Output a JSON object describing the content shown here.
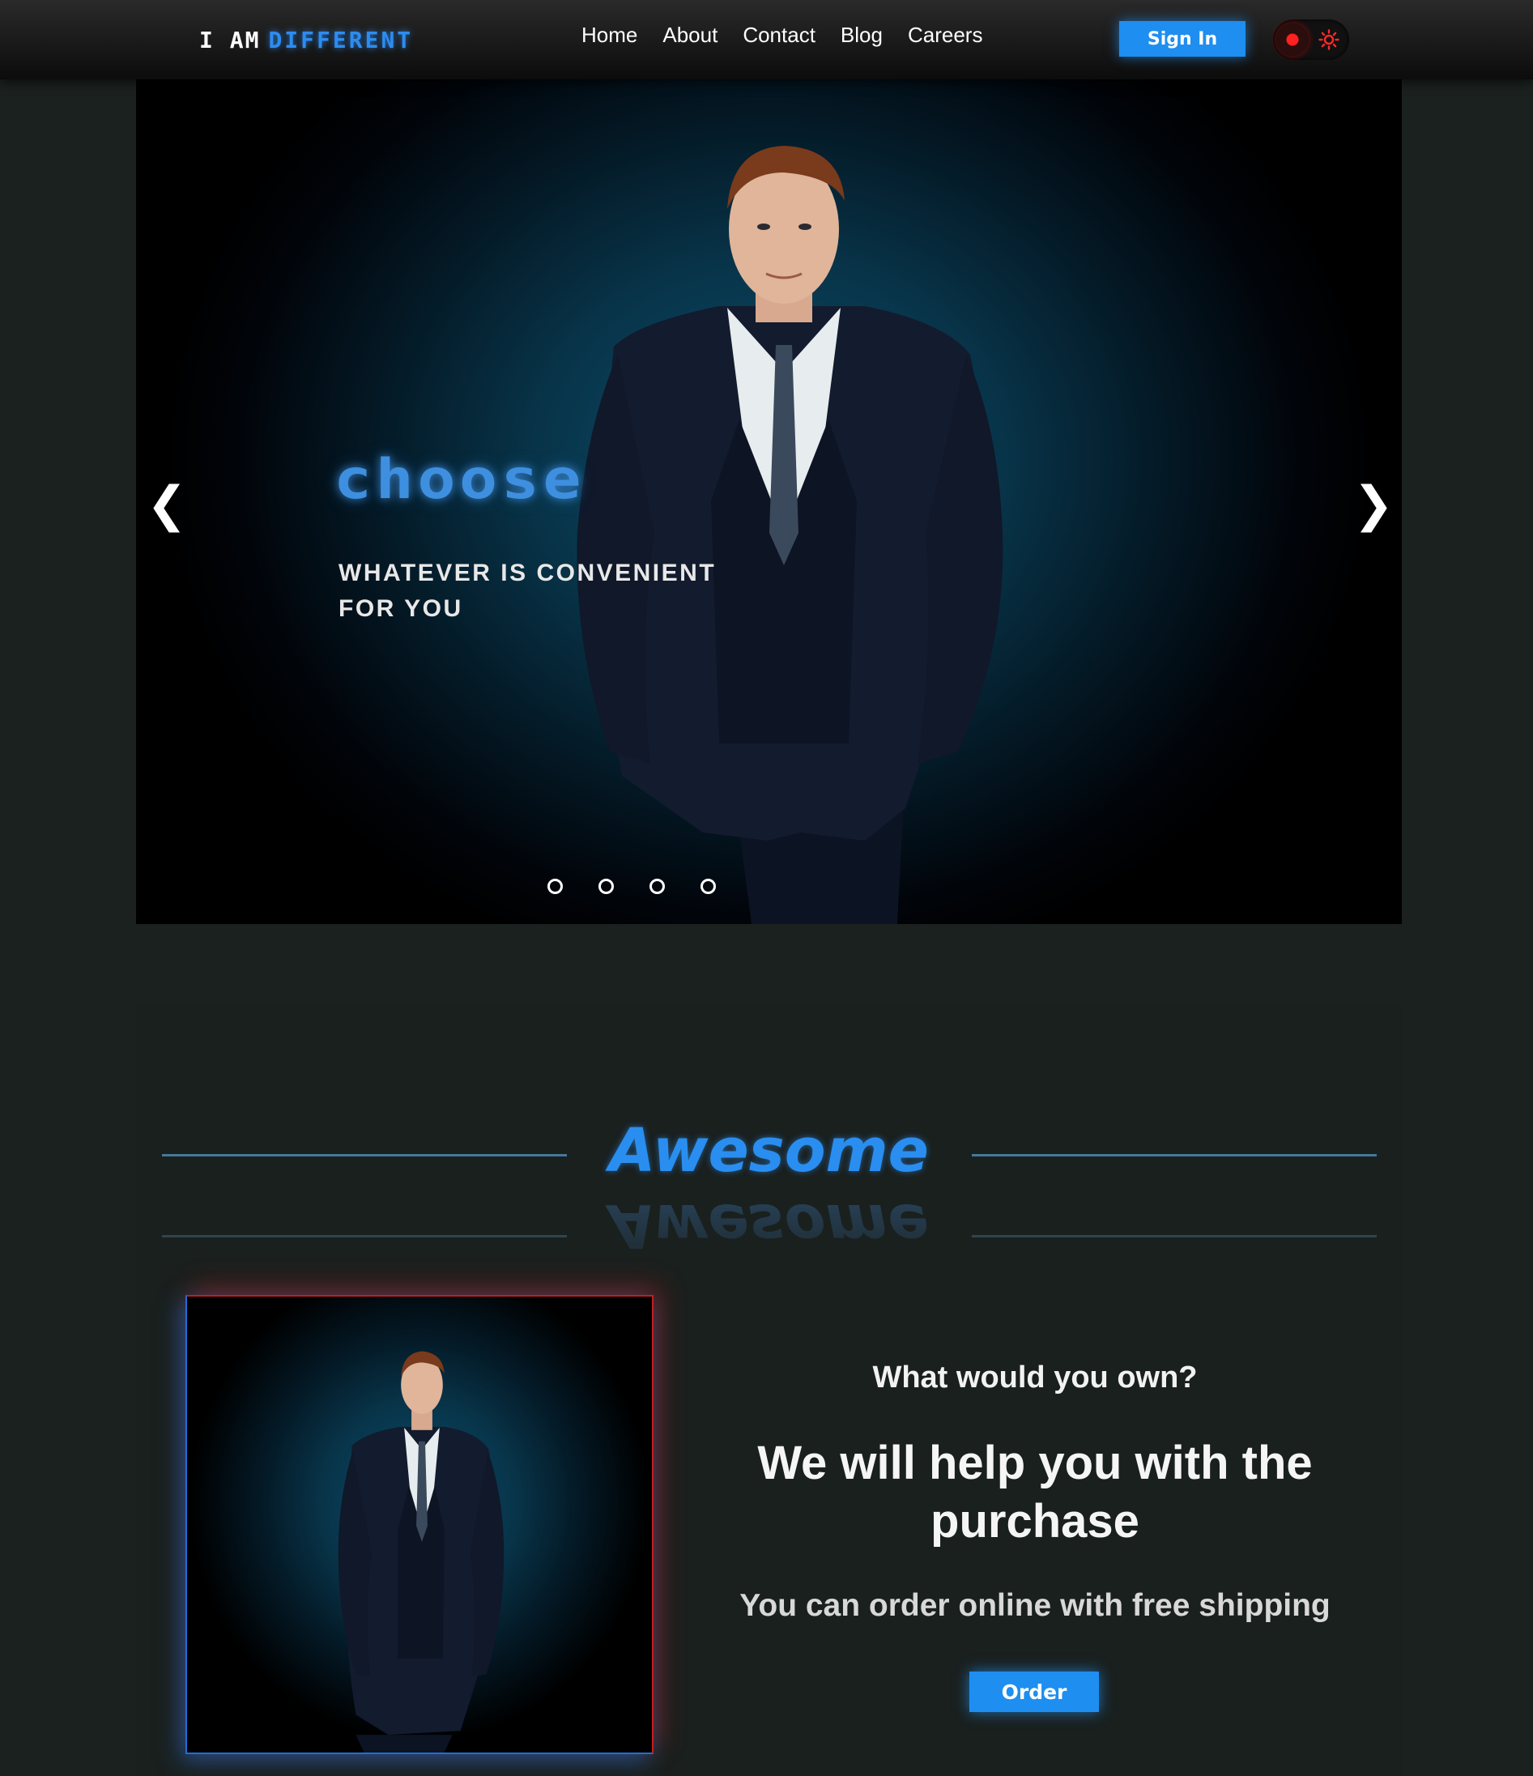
{
  "nav": {
    "logo_prefix": "I AM",
    "logo_word": "different",
    "links": [
      "Home",
      "About",
      "Contact",
      "Blog",
      "Careers"
    ],
    "signin_label": "Sign In",
    "theme_icon": "sun-icon"
  },
  "hero": {
    "title": "choose",
    "subtitle": "WHATEVER IS CONVENIENT FOR YOU",
    "prev_glyph": "❮",
    "next_glyph": "❯",
    "slide_count": 4
  },
  "section": {
    "heading": "Awesome",
    "question": "What would you own?",
    "headline": "We will help you with the purchase",
    "subline": "You can order online with free shipping",
    "order_label": "Order"
  },
  "colors": {
    "accent": "#1e8ef0",
    "background": "#1b211f",
    "glow_red": "#c21e1e"
  }
}
